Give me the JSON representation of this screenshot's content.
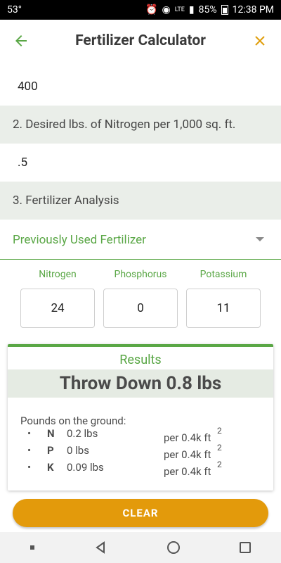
{
  "status_bar": {
    "temperature": "53°",
    "battery": "85%",
    "time": "12:38 PM",
    "network": "LTE"
  },
  "appbar": {
    "title": "Fertilizer Calculator",
    "back_icon": "arrow-left-icon",
    "close_icon": "close-icon"
  },
  "inputs": {
    "area_value": "400",
    "nitrogen_header": "2. Desired lbs. of Nitrogen per 1,000 sq. ft.",
    "nitrogen_value": ".5",
    "analysis_header": "3. Fertilizer Analysis",
    "dropdown_selected": "Previously Used Fertilizer"
  },
  "nutrients": [
    {
      "label": "Nitrogen",
      "value": "24"
    },
    {
      "label": "Phosphorus",
      "value": "0"
    },
    {
      "label": "Potassium",
      "value": "11"
    }
  ],
  "results": {
    "title": "Results",
    "throw_text": "Throw Down 0.8 lbs",
    "pounds_label": "Pounds on the ground:",
    "rows": [
      {
        "letter": "N",
        "amount": "0.2 lbs",
        "per": "per 0.4k ft",
        "sup": "2"
      },
      {
        "letter": "P",
        "amount": "0 lbs",
        "per": "per 0.4k ft",
        "sup": "2"
      },
      {
        "letter": "K",
        "amount": "0.09 lbs",
        "per": "per 0.4k ft",
        "sup": "2"
      }
    ]
  },
  "clear_button": "CLEAR",
  "colors": {
    "accent_green": "#5aa746",
    "accent_orange": "#e39a0b",
    "section_bg": "#eaeee9"
  }
}
